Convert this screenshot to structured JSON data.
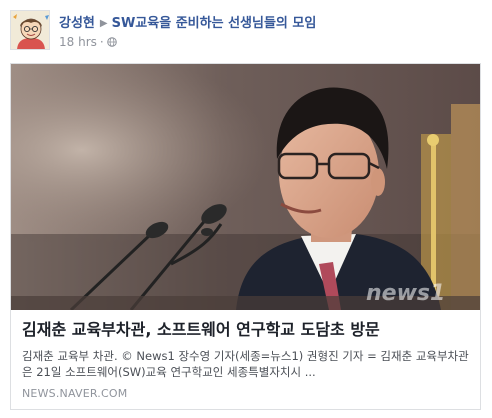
{
  "post": {
    "author": "강성현",
    "group": "SW교육을 준비하는 선생님들의 모임",
    "time": "18 hrs",
    "separator": "·",
    "privacy_icon": "globe-icon",
    "avatar_icon": "cartoon-avatar"
  },
  "link": {
    "title": "김재춘 교육부차관, 소프트웨어 연구학교 도담초 방문",
    "description": "김재춘 교육부 차관. © News1 장수영 기자(세종=뉴스1) 권형진 기자 = 김재춘 교육부차관은 21일 소프트웨어(SW)교육 연구학교인 세종특별자치시 ...",
    "domain": "NEWS.NAVER.COM",
    "image_watermark": "news1"
  },
  "colors": {
    "link_blue": "#365899",
    "meta_gray": "#90949c",
    "border": "#dddfe2"
  }
}
